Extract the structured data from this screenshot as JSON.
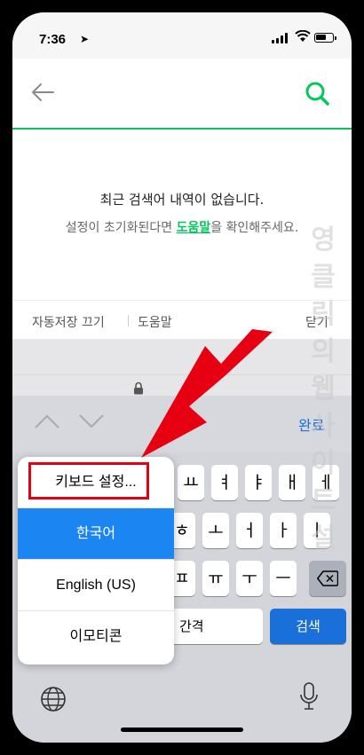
{
  "status_bar": {
    "time": "7:36"
  },
  "header": {},
  "main": {
    "empty_title": "최근 검색어 내역이 없습니다.",
    "empty_desc_before": "설정이 초기화된다면 ",
    "empty_desc_link": "도움말",
    "empty_desc_after": "을 확인해주세요."
  },
  "bottom_bar": {
    "autosave": "자동저장 끄기",
    "help": "도움말",
    "close": "닫기"
  },
  "accessory": {
    "done": "완료"
  },
  "keyboard": {
    "row1": [
      "ㅛ",
      "ㅕ",
      "ㅑ",
      "ㅐ",
      "ㅔ"
    ],
    "row2": [
      "ㅎ",
      "ㅗ",
      "ㅓ",
      "ㅏ",
      "ㅣ"
    ],
    "row3": [
      "ㅍ",
      "ㅠ",
      "ㅜ",
      "ㅡ"
    ],
    "space_partial": "간격",
    "search": "검색"
  },
  "popup": {
    "items": [
      "키보드 설정...",
      "한국어",
      "English (US)",
      "이모티콘"
    ],
    "selected": "한국어"
  },
  "annotation": {
    "arrow_color": "#e60012"
  },
  "watermark": "영클릭의웹사이트설",
  "colors": {
    "accent": "#03c75a",
    "ios_blue": "#1b6fd8",
    "highlight": "#e60012"
  }
}
